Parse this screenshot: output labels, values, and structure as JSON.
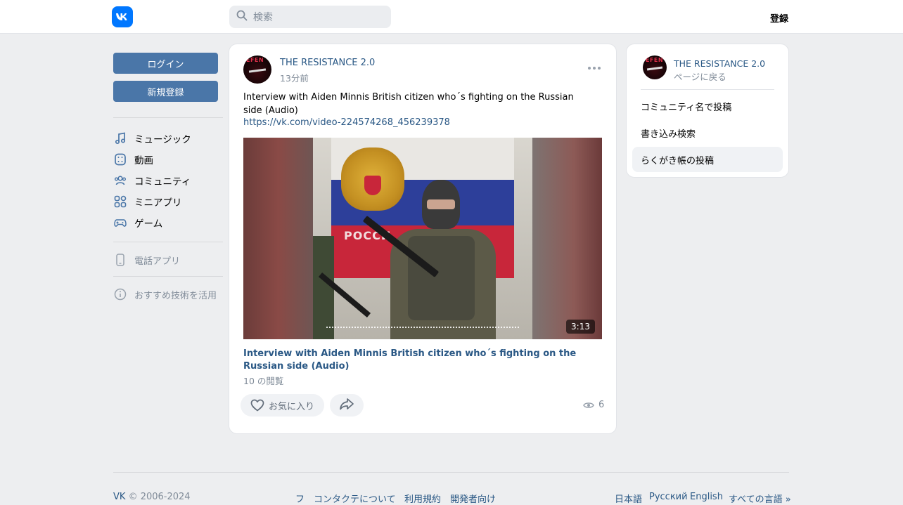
{
  "header": {
    "logo_icon": "vk-logo-icon",
    "search_placeholder": "検索",
    "register_label": "登録"
  },
  "sidebar": {
    "login_label": "ログイン",
    "signup_label": "新規登録",
    "items": [
      {
        "label": "ミュージック",
        "icon": "music-note-icon"
      },
      {
        "label": "動画",
        "icon": "video-icon"
      },
      {
        "label": "コミュニティ",
        "icon": "users-icon"
      },
      {
        "label": "ミニアプリ",
        "icon": "apps-grid-icon"
      },
      {
        "label": "ゲーム",
        "icon": "gamepad-icon"
      }
    ],
    "phone_app_label": "電話アプリ",
    "recommend_label": "おすすめ技術を活用"
  },
  "post": {
    "author": "THE RESISTANCE 2.0",
    "time": "13分前",
    "text": "Interview with Aiden Minnis British citizen who´s fighting on the Russian side (Audio)",
    "link": "https://vk.com/video-224574268_456239378",
    "video": {
      "duration": "3:13",
      "title": "Interview with Aiden Minnis British citizen who´s fighting on the Russian side (Audio)",
      "views": "10 の閲覧",
      "flag_text": "РОССИ"
    },
    "like_label": "お気に入り",
    "view_count": "6"
  },
  "right_panel": {
    "community": "THE RESISTANCE 2.0",
    "back_label": "ページに戻る",
    "items": [
      {
        "label": "コミュニティ名で投稿",
        "active": false
      },
      {
        "label": "書き込み検索",
        "active": false
      },
      {
        "label": "らくがき帳の投稿",
        "active": true
      }
    ]
  },
  "footer": {
    "brand": "VK",
    "copyright": "© 2006-2024",
    "links": [
      "フ",
      "コンタクテについて",
      "利用規約",
      "開発者向け"
    ],
    "languages": [
      "日本語",
      "Русский",
      "English",
      "すべての言語 »"
    ]
  },
  "colors": {
    "accent": "#4a76a8",
    "link": "#2a5885",
    "brand": "#0077ff",
    "background": "#edeef0"
  }
}
